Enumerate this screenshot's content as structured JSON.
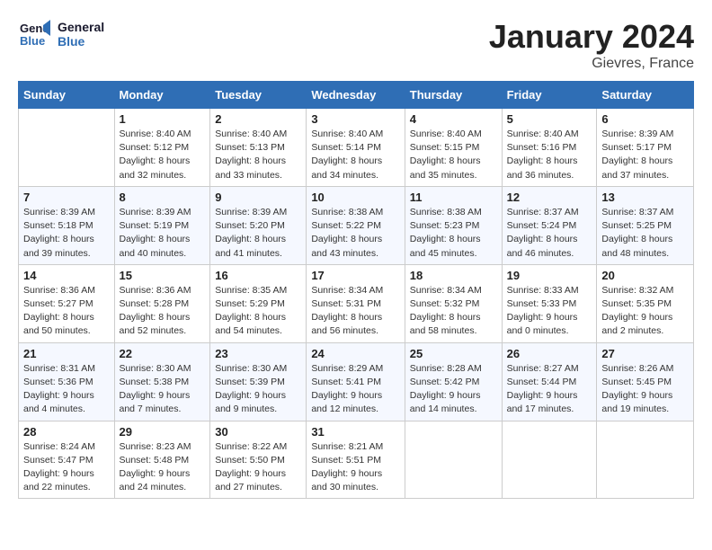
{
  "header": {
    "logo_line1": "General",
    "logo_line2": "Blue",
    "month": "January 2024",
    "location": "Gievres, France"
  },
  "days_of_week": [
    "Sunday",
    "Monday",
    "Tuesday",
    "Wednesday",
    "Thursday",
    "Friday",
    "Saturday"
  ],
  "weeks": [
    [
      {
        "day": "",
        "sunrise": "",
        "sunset": "",
        "daylight": ""
      },
      {
        "day": "1",
        "sunrise": "Sunrise: 8:40 AM",
        "sunset": "Sunset: 5:12 PM",
        "daylight": "Daylight: 8 hours and 32 minutes."
      },
      {
        "day": "2",
        "sunrise": "Sunrise: 8:40 AM",
        "sunset": "Sunset: 5:13 PM",
        "daylight": "Daylight: 8 hours and 33 minutes."
      },
      {
        "day": "3",
        "sunrise": "Sunrise: 8:40 AM",
        "sunset": "Sunset: 5:14 PM",
        "daylight": "Daylight: 8 hours and 34 minutes."
      },
      {
        "day": "4",
        "sunrise": "Sunrise: 8:40 AM",
        "sunset": "Sunset: 5:15 PM",
        "daylight": "Daylight: 8 hours and 35 minutes."
      },
      {
        "day": "5",
        "sunrise": "Sunrise: 8:40 AM",
        "sunset": "Sunset: 5:16 PM",
        "daylight": "Daylight: 8 hours and 36 minutes."
      },
      {
        "day": "6",
        "sunrise": "Sunrise: 8:39 AM",
        "sunset": "Sunset: 5:17 PM",
        "daylight": "Daylight: 8 hours and 37 minutes."
      }
    ],
    [
      {
        "day": "7",
        "sunrise": "Sunrise: 8:39 AM",
        "sunset": "Sunset: 5:18 PM",
        "daylight": "Daylight: 8 hours and 39 minutes."
      },
      {
        "day": "8",
        "sunrise": "Sunrise: 8:39 AM",
        "sunset": "Sunset: 5:19 PM",
        "daylight": "Daylight: 8 hours and 40 minutes."
      },
      {
        "day": "9",
        "sunrise": "Sunrise: 8:39 AM",
        "sunset": "Sunset: 5:20 PM",
        "daylight": "Daylight: 8 hours and 41 minutes."
      },
      {
        "day": "10",
        "sunrise": "Sunrise: 8:38 AM",
        "sunset": "Sunset: 5:22 PM",
        "daylight": "Daylight: 8 hours and 43 minutes."
      },
      {
        "day": "11",
        "sunrise": "Sunrise: 8:38 AM",
        "sunset": "Sunset: 5:23 PM",
        "daylight": "Daylight: 8 hours and 45 minutes."
      },
      {
        "day": "12",
        "sunrise": "Sunrise: 8:37 AM",
        "sunset": "Sunset: 5:24 PM",
        "daylight": "Daylight: 8 hours and 46 minutes."
      },
      {
        "day": "13",
        "sunrise": "Sunrise: 8:37 AM",
        "sunset": "Sunset: 5:25 PM",
        "daylight": "Daylight: 8 hours and 48 minutes."
      }
    ],
    [
      {
        "day": "14",
        "sunrise": "Sunrise: 8:36 AM",
        "sunset": "Sunset: 5:27 PM",
        "daylight": "Daylight: 8 hours and 50 minutes."
      },
      {
        "day": "15",
        "sunrise": "Sunrise: 8:36 AM",
        "sunset": "Sunset: 5:28 PM",
        "daylight": "Daylight: 8 hours and 52 minutes."
      },
      {
        "day": "16",
        "sunrise": "Sunrise: 8:35 AM",
        "sunset": "Sunset: 5:29 PM",
        "daylight": "Daylight: 8 hours and 54 minutes."
      },
      {
        "day": "17",
        "sunrise": "Sunrise: 8:34 AM",
        "sunset": "Sunset: 5:31 PM",
        "daylight": "Daylight: 8 hours and 56 minutes."
      },
      {
        "day": "18",
        "sunrise": "Sunrise: 8:34 AM",
        "sunset": "Sunset: 5:32 PM",
        "daylight": "Daylight: 8 hours and 58 minutes."
      },
      {
        "day": "19",
        "sunrise": "Sunrise: 8:33 AM",
        "sunset": "Sunset: 5:33 PM",
        "daylight": "Daylight: 9 hours and 0 minutes."
      },
      {
        "day": "20",
        "sunrise": "Sunrise: 8:32 AM",
        "sunset": "Sunset: 5:35 PM",
        "daylight": "Daylight: 9 hours and 2 minutes."
      }
    ],
    [
      {
        "day": "21",
        "sunrise": "Sunrise: 8:31 AM",
        "sunset": "Sunset: 5:36 PM",
        "daylight": "Daylight: 9 hours and 4 minutes."
      },
      {
        "day": "22",
        "sunrise": "Sunrise: 8:30 AM",
        "sunset": "Sunset: 5:38 PM",
        "daylight": "Daylight: 9 hours and 7 minutes."
      },
      {
        "day": "23",
        "sunrise": "Sunrise: 8:30 AM",
        "sunset": "Sunset: 5:39 PM",
        "daylight": "Daylight: 9 hours and 9 minutes."
      },
      {
        "day": "24",
        "sunrise": "Sunrise: 8:29 AM",
        "sunset": "Sunset: 5:41 PM",
        "daylight": "Daylight: 9 hours and 12 minutes."
      },
      {
        "day": "25",
        "sunrise": "Sunrise: 8:28 AM",
        "sunset": "Sunset: 5:42 PM",
        "daylight": "Daylight: 9 hours and 14 minutes."
      },
      {
        "day": "26",
        "sunrise": "Sunrise: 8:27 AM",
        "sunset": "Sunset: 5:44 PM",
        "daylight": "Daylight: 9 hours and 17 minutes."
      },
      {
        "day": "27",
        "sunrise": "Sunrise: 8:26 AM",
        "sunset": "Sunset: 5:45 PM",
        "daylight": "Daylight: 9 hours and 19 minutes."
      }
    ],
    [
      {
        "day": "28",
        "sunrise": "Sunrise: 8:24 AM",
        "sunset": "Sunset: 5:47 PM",
        "daylight": "Daylight: 9 hours and 22 minutes."
      },
      {
        "day": "29",
        "sunrise": "Sunrise: 8:23 AM",
        "sunset": "Sunset: 5:48 PM",
        "daylight": "Daylight: 9 hours and 24 minutes."
      },
      {
        "day": "30",
        "sunrise": "Sunrise: 8:22 AM",
        "sunset": "Sunset: 5:50 PM",
        "daylight": "Daylight: 9 hours and 27 minutes."
      },
      {
        "day": "31",
        "sunrise": "Sunrise: 8:21 AM",
        "sunset": "Sunset: 5:51 PM",
        "daylight": "Daylight: 9 hours and 30 minutes."
      },
      {
        "day": "",
        "sunrise": "",
        "sunset": "",
        "daylight": ""
      },
      {
        "day": "",
        "sunrise": "",
        "sunset": "",
        "daylight": ""
      },
      {
        "day": "",
        "sunrise": "",
        "sunset": "",
        "daylight": ""
      }
    ]
  ]
}
